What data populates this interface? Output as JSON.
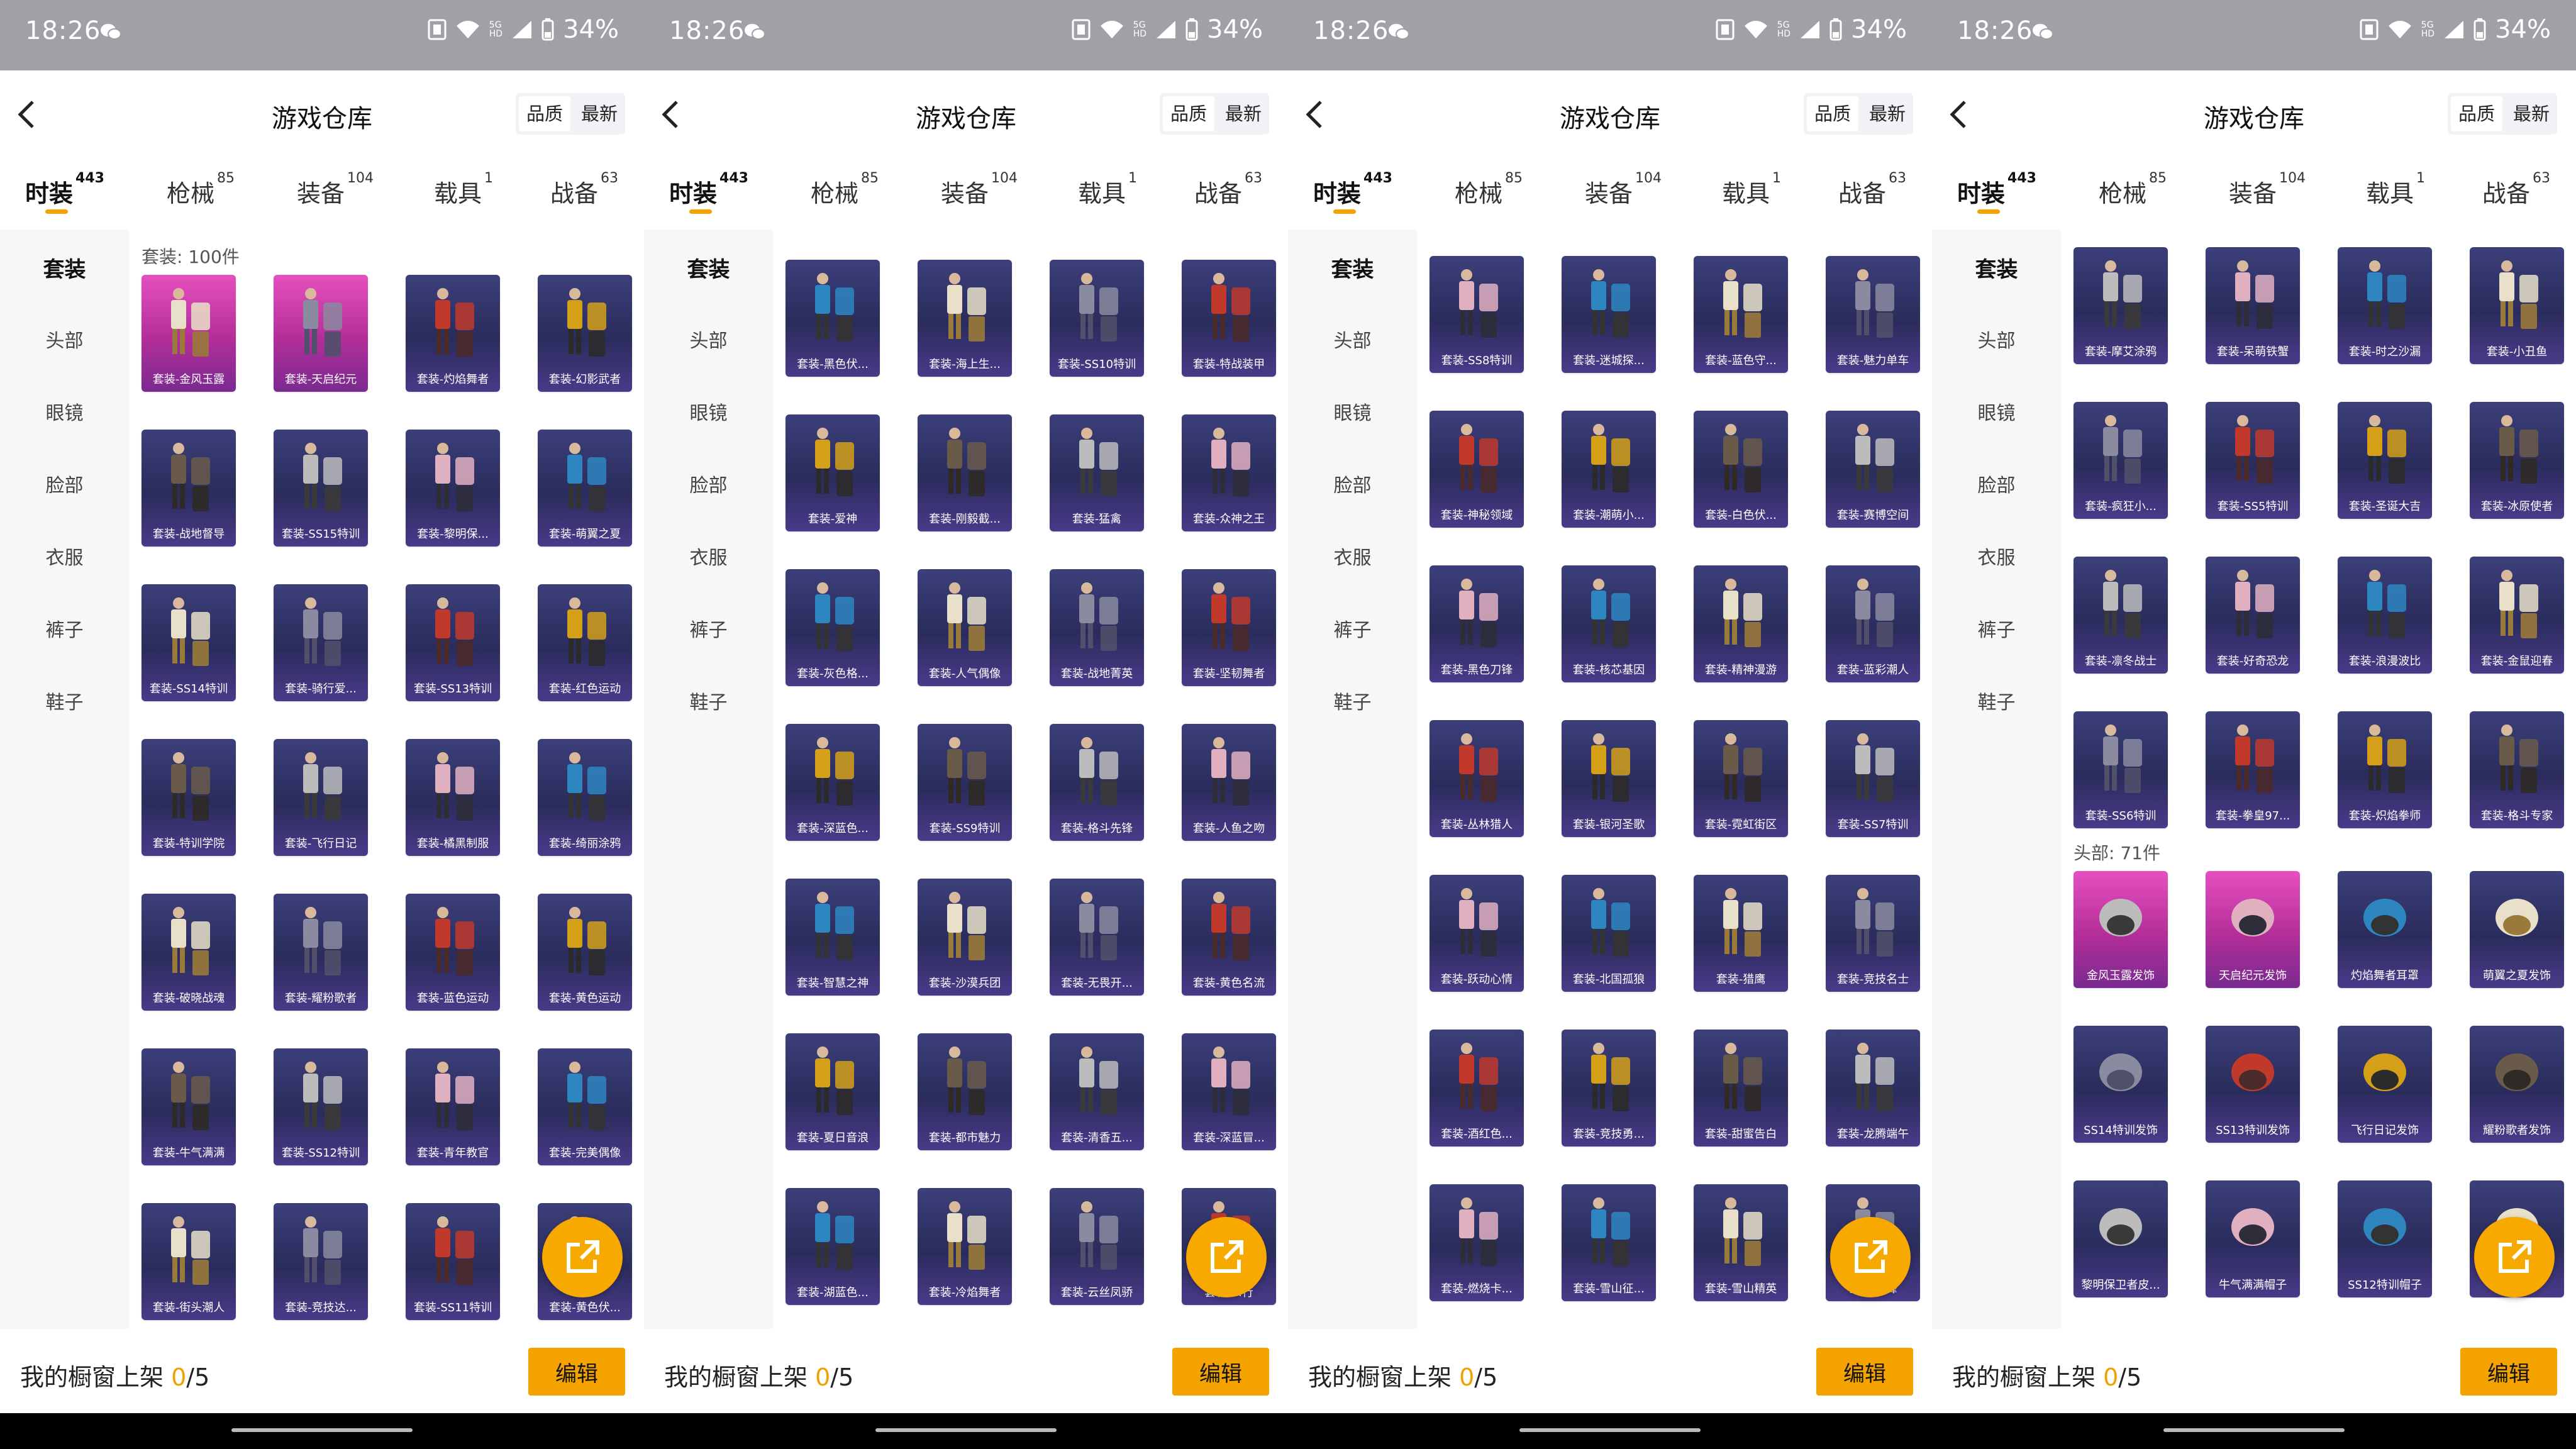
{
  "status": {
    "time": "18:26",
    "battery": "34%",
    "signal_top": "5G",
    "signal_bottom": "HD"
  },
  "header": {
    "title": "游戏仓库",
    "sort_quality": "品质",
    "sort_latest": "最新"
  },
  "tabs": [
    {
      "label": "时装",
      "count": "443"
    },
    {
      "label": "枪械",
      "count": "85"
    },
    {
      "label": "装备",
      "count": "104"
    },
    {
      "label": "载具",
      "count": "1"
    },
    {
      "label": "战备",
      "count": "63"
    }
  ],
  "sidebar": [
    "套装",
    "头部",
    "眼镜",
    "脸部",
    "衣服",
    "裤子",
    "鞋子"
  ],
  "panels": [
    {
      "section_label": "套装: 100件",
      "rows": [
        [
          "套装-金风玉露",
          "套装-天启纪元",
          "套装-灼焰舞者",
          "套装-幻影武者"
        ],
        [
          "套装-战地督导",
          "套装-SS15特训",
          "套装-黎明保...",
          "套装-萌翼之夏"
        ],
        [
          "套装-SS14特训",
          "套装-骑行爱...",
          "套装-SS13特训",
          "套装-红色运动"
        ],
        [
          "套装-特训学院",
          "套装-飞行日记",
          "套装-橘黑制服",
          "套装-绮丽涂鸦"
        ],
        [
          "套装-破晓战魂",
          "套装-耀粉歌者",
          "套装-蓝色运动",
          "套装-黄色运动"
        ],
        [
          "套装-牛气满满",
          "套装-SS12特训",
          "套装-青年教官",
          "套装-完美偶像"
        ],
        [
          "套装-街头潮人",
          "套装-竞技达...",
          "套装-SS11特训",
          "套装-黄色伏..."
        ]
      ]
    },
    {
      "section_label": "",
      "rows": [
        [
          "套装-黑色伏...",
          "套装-海上生...",
          "套装-SS10特训",
          "套装-特战装甲"
        ],
        [
          "套装-爱神",
          "套装-刚毅截...",
          "套装-猛禽",
          "套装-众神之王"
        ],
        [
          "套装-灰色格...",
          "套装-人气偶像",
          "套装-战地菁英",
          "套装-坚韧舞者"
        ],
        [
          "套装-深蓝色...",
          "套装-SS9特训",
          "套装-格斗先锋",
          "套装-人鱼之吻"
        ],
        [
          "套装-智慧之神",
          "套装-沙漠兵团",
          "套装-无畏开...",
          "套装-黄色名流"
        ],
        [
          "套装-夏日音浪",
          "套装-都市魅力",
          "套装-清香五...",
          "套装-深蓝冒..."
        ],
        [
          "套装-湖蓝色...",
          "套装-冷焰舞者",
          "套装-云丝凤骄",
          "套装-...行"
        ]
      ]
    },
    {
      "section_label": "",
      "rows": [
        [
          "套装-SS8特训",
          "套装-迷城探...",
          "套装-蓝色守...",
          "套装-魅力单车"
        ],
        [
          "套装-神秘领域",
          "套装-潮萌小...",
          "套装-白色伏...",
          "套装-赛博空间"
        ],
        [
          "套装-黑色刀锋",
          "套装-核芯基因",
          "套装-精神漫游",
          "套装-蓝彩潮人"
        ],
        [
          "套装-丛林猎人",
          "套装-银河圣歌",
          "套装-霓虹街区",
          "套装-SS7特训"
        ],
        [
          "套装-跃动心情",
          "套装-北国孤狼",
          "套装-猎鹰",
          "套装-竞技名士"
        ],
        [
          "套装-酒红色...",
          "套装-竞技勇...",
          "套装-甜蜜告白",
          "套装-龙腾端午"
        ],
        [
          "套装-燃烧卡...",
          "套装-雪山征...",
          "套装-雪山精英",
          "套装-...锋"
        ]
      ]
    },
    {
      "section_label": "头部: 71件",
      "rows": [
        [
          "套装-摩艾涂鸦",
          "套装-呆萌铁蟹",
          "套装-时之沙漏",
          "套装-小丑鱼"
        ],
        [
          "套装-疯狂小...",
          "套装-SS5特训",
          "套装-圣诞大吉",
          "套装-冰原使者"
        ],
        [
          "套装-凛冬战士",
          "套装-好奇恐龙",
          "套装-浪漫波比",
          "套装-金鼠迎春"
        ],
        [
          "套装-SS6特训",
          "套装-拳皇97...",
          "套装-炽焰拳师",
          "套装-格斗专家"
        ],
        [
          "金风玉露发饰",
          "天启纪元发饰",
          "灼焰舞者耳罩",
          "萌翼之夏发饰"
        ],
        [
          "SS14特训发饰",
          "SS13特训发饰",
          "飞行日记发饰",
          "耀粉歌者发饰"
        ],
        [
          "黎明保卫者皮...",
          "牛气满满帽子",
          "SS12特训帽子",
          "...子"
        ]
      ]
    }
  ],
  "bottom": {
    "showcase_label": "我的橱窗上架",
    "showcase_count": "0",
    "showcase_total": "/5",
    "edit_label": "编辑"
  }
}
